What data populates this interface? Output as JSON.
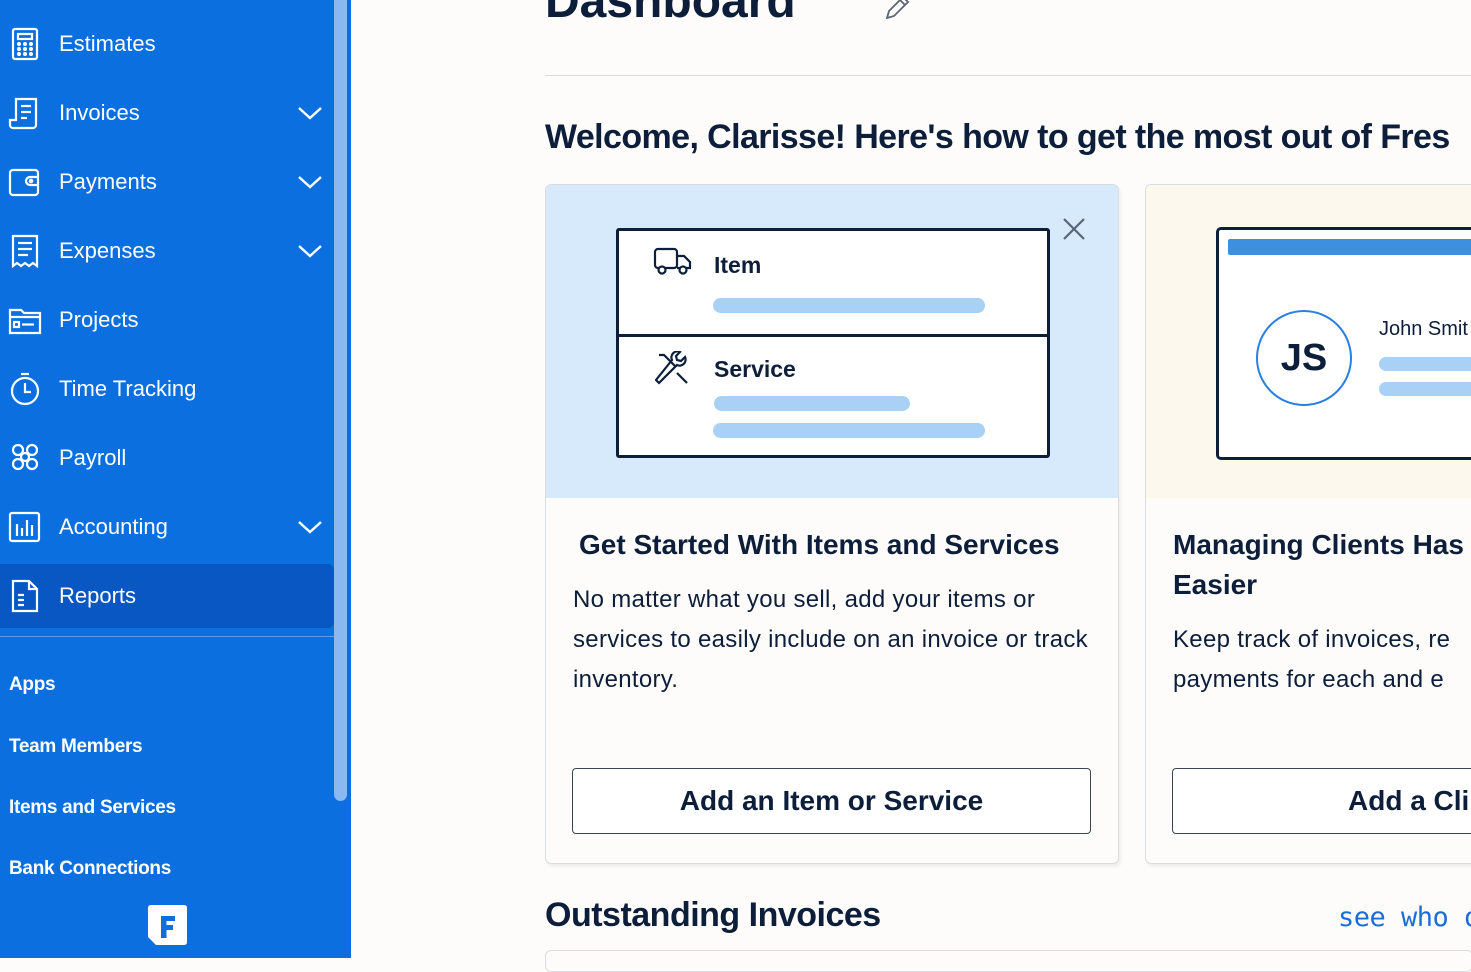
{
  "sidebar": {
    "items": [
      {
        "label": "Estimates",
        "icon": "calculator-icon",
        "has_chevron": false
      },
      {
        "label": "Invoices",
        "icon": "invoice-icon",
        "has_chevron": true
      },
      {
        "label": "Payments",
        "icon": "wallet-icon",
        "has_chevron": true
      },
      {
        "label": "Expenses",
        "icon": "receipt-icon",
        "has_chevron": true
      },
      {
        "label": "Projects",
        "icon": "folder-icon",
        "has_chevron": false
      },
      {
        "label": "Time Tracking",
        "icon": "stopwatch-icon",
        "has_chevron": false
      },
      {
        "label": "Payroll",
        "icon": "people-icon",
        "has_chevron": false
      },
      {
        "label": "Accounting",
        "icon": "bar-chart-icon",
        "has_chevron": true
      },
      {
        "label": "Reports",
        "icon": "report-icon",
        "has_chevron": false,
        "active": true
      }
    ],
    "sub_items": [
      "Apps",
      "Team Members",
      "Items and Services",
      "Bank Connections"
    ],
    "logo_icon": "freshbooks-logo-icon"
  },
  "main": {
    "title": "Dashboard",
    "welcome": "Welcome, Clarisse! Here's how to get the most out of Fres",
    "cards": [
      {
        "title": "Get Started With Items and Services",
        "description": "No matter what you sell, add your items or services to easily include on an invoice or track inventory.",
        "button": "Add an Item or Service",
        "illustration": {
          "row1": "Item",
          "row2": "Service"
        }
      },
      {
        "title": "Managing Clients Has Easier",
        "title_line1": "Managing Clients Has",
        "title_line2": "Easier",
        "description_line1": "Keep track of invoices, re",
        "description_line2": "payments for each and e",
        "button": "Add a Cli",
        "illustration": {
          "initials": "JS",
          "name": "John Smit"
        }
      }
    ],
    "section_title": "Outstanding Invoices",
    "see_who_link": "see who ou"
  },
  "colors": {
    "sidebar_bg": "#0b6fe0",
    "sidebar_active": "#0957c2",
    "text_dark": "#0d1e3a",
    "hero_blue": "#d6eafc",
    "accent_link": "#1a6ed8"
  }
}
